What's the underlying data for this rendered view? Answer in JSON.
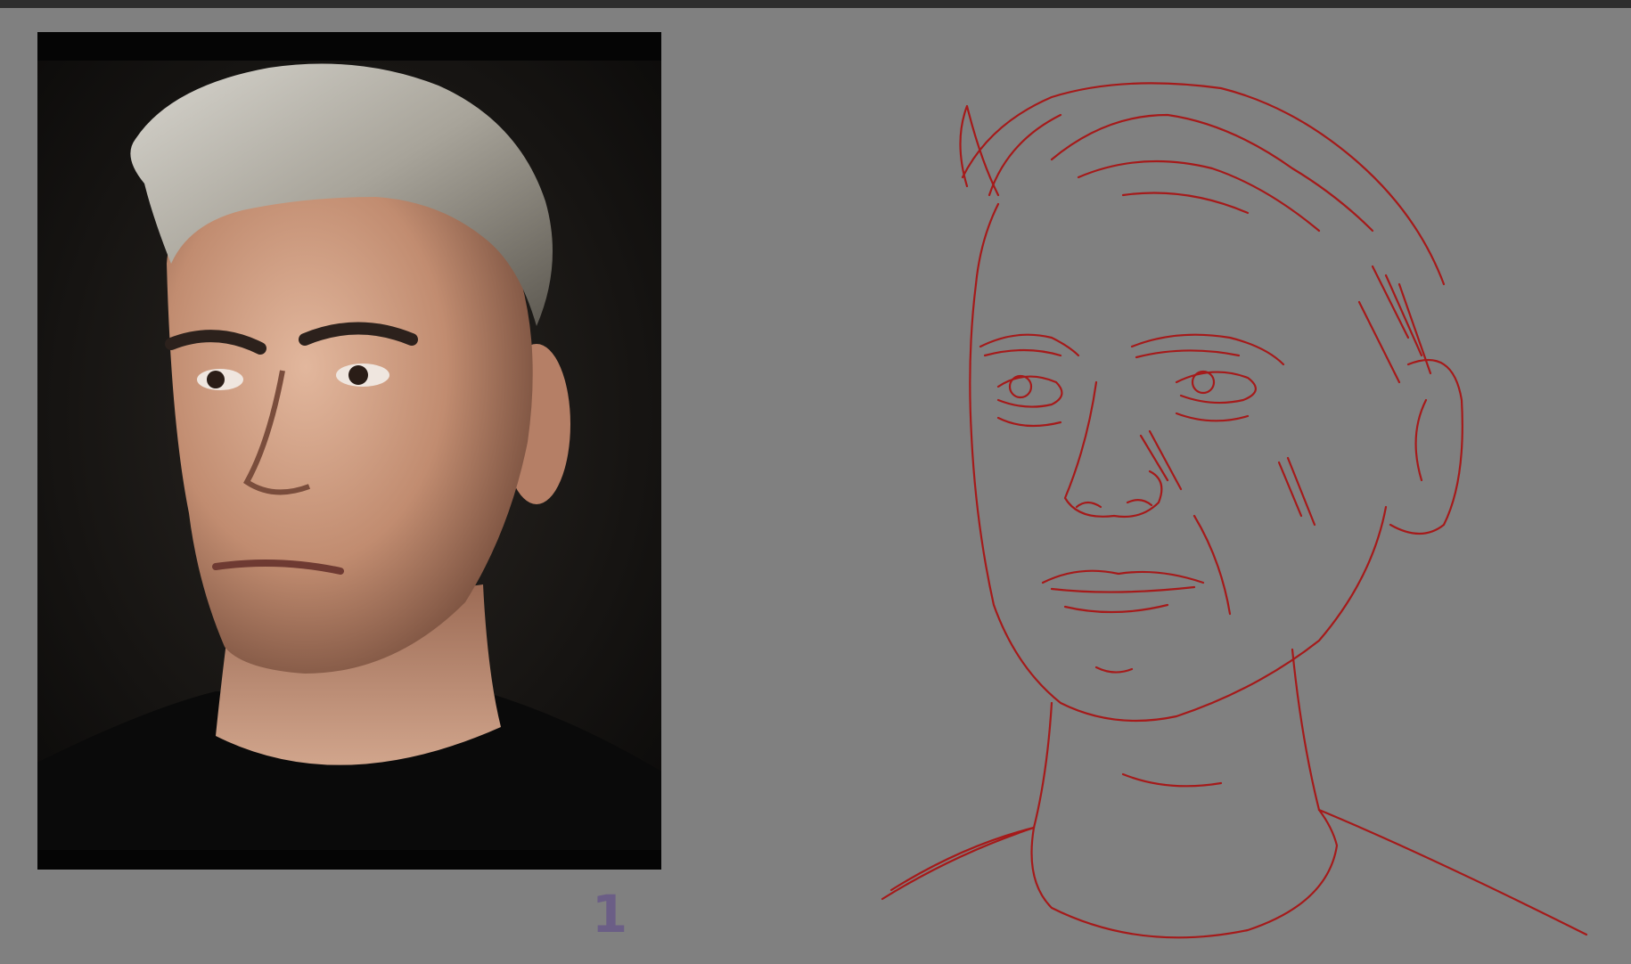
{
  "canvas": {
    "background_color": "#808080",
    "topbar_color": "#2e2e2e"
  },
  "reference_photo": {
    "subject": "portrait-photo",
    "background_color": "#050505"
  },
  "page_number": {
    "label": "1",
    "color": "#6b5e86"
  },
  "sketch": {
    "subject": "portrait-sketch",
    "stroke_color": "#a51a1a"
  }
}
